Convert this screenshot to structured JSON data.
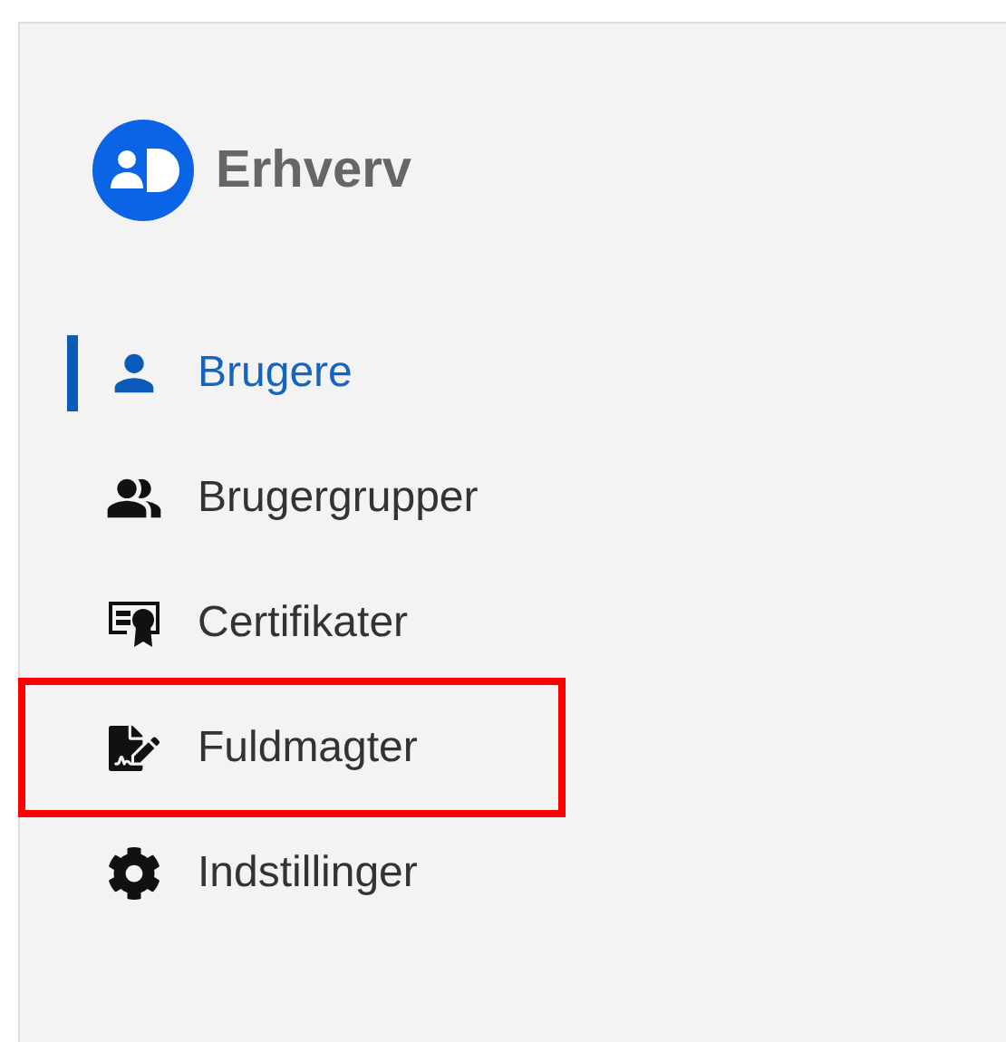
{
  "brand": {
    "name": "Erhverv"
  },
  "items": [
    {
      "label": "Brugere",
      "selected": true,
      "highlighted": false
    },
    {
      "label": "Brugergrupper",
      "selected": false,
      "highlighted": false
    },
    {
      "label": "Certifikater",
      "selected": false,
      "highlighted": false
    },
    {
      "label": "Fuldmagter",
      "selected": false,
      "highlighted": true
    },
    {
      "label": "Indstillinger",
      "selected": false,
      "highlighted": false
    }
  ]
}
